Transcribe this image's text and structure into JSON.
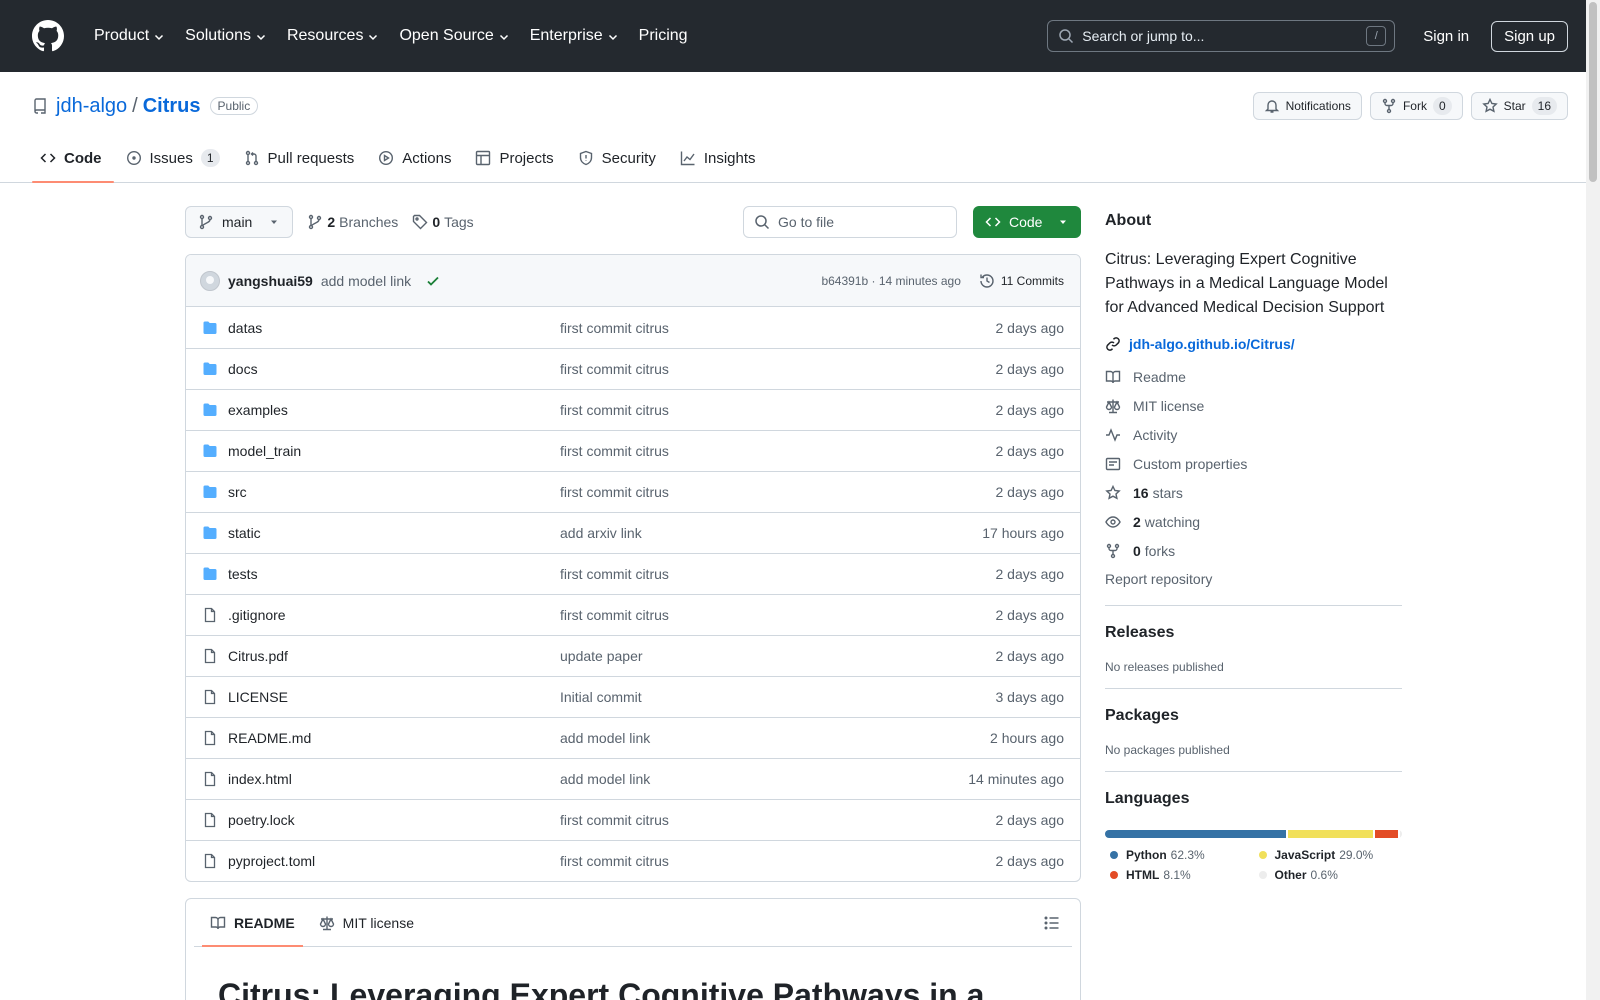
{
  "header": {
    "nav": [
      "Product",
      "Solutions",
      "Resources",
      "Open Source",
      "Enterprise",
      "Pricing"
    ],
    "search_placeholder": "Search or jump to...",
    "slash_key": "/",
    "signin": "Sign in",
    "signup": "Sign up"
  },
  "repo": {
    "owner": "jdh-algo",
    "separator": "/",
    "name": "Citrus",
    "visibility": "Public",
    "notifications_label": "Notifications",
    "fork_label": "Fork",
    "fork_count": "0",
    "star_label": "Star",
    "star_count": "16"
  },
  "tabs": {
    "code": "Code",
    "issues": "Issues",
    "issues_count": "1",
    "pulls": "Pull requests",
    "actions": "Actions",
    "projects": "Projects",
    "security": "Security",
    "insights": "Insights"
  },
  "toolbar": {
    "branch": "main",
    "branches_count": "2",
    "branches_label": "Branches",
    "tags_count": "0",
    "tags_label": "Tags",
    "goto_placeholder": "Go to file",
    "code_button": "Code"
  },
  "commit": {
    "author": "yangshuai59",
    "message": "add model link",
    "meta": "b64391b · 14 minutes ago",
    "commits_label": "11 Commits"
  },
  "files": [
    {
      "type": "folder",
      "name": "datas",
      "commit": "first commit citrus",
      "time": "2 days ago"
    },
    {
      "type": "folder",
      "name": "docs",
      "commit": "first commit citrus",
      "time": "2 days ago"
    },
    {
      "type": "folder",
      "name": "examples",
      "commit": "first commit citrus",
      "time": "2 days ago"
    },
    {
      "type": "folder",
      "name": "model_train",
      "commit": "first commit citrus",
      "time": "2 days ago"
    },
    {
      "type": "folder",
      "name": "src",
      "commit": "first commit citrus",
      "time": "2 days ago"
    },
    {
      "type": "folder",
      "name": "static",
      "commit": "add arxiv link",
      "time": "17 hours ago"
    },
    {
      "type": "folder",
      "name": "tests",
      "commit": "first commit citrus",
      "time": "2 days ago"
    },
    {
      "type": "file",
      "name": ".gitignore",
      "commit": "first commit citrus",
      "time": "2 days ago"
    },
    {
      "type": "file",
      "name": "Citrus.pdf",
      "commit": "update paper",
      "time": "2 days ago"
    },
    {
      "type": "file",
      "name": "LICENSE",
      "commit": "Initial commit",
      "time": "3 days ago"
    },
    {
      "type": "file",
      "name": "README.md",
      "commit": "add model link",
      "time": "2 hours ago"
    },
    {
      "type": "file",
      "name": "index.html",
      "commit": "add model link",
      "time": "14 minutes ago"
    },
    {
      "type": "file",
      "name": "poetry.lock",
      "commit": "first commit citrus",
      "time": "2 days ago"
    },
    {
      "type": "file",
      "name": "pyproject.toml",
      "commit": "first commit citrus",
      "time": "2 days ago"
    }
  ],
  "readme": {
    "tab_readme": "README",
    "tab_license": "MIT license",
    "heading": "Citrus: Leveraging Expert Cognitive Pathways in a"
  },
  "about": {
    "title": "About",
    "description": "Citrus: Leveraging Expert Cognitive Pathways in a Medical Language Model for Advanced Medical Decision Support",
    "link": "jdh-algo.github.io/Citrus/",
    "readme": "Readme",
    "license": "MIT license",
    "activity": "Activity",
    "custom_properties": "Custom properties",
    "stars_count": "16",
    "stars_label": "stars",
    "watching_count": "2",
    "watching_label": "watching",
    "forks_count": "0",
    "forks_label": "forks",
    "report": "Report repository"
  },
  "releases": {
    "title": "Releases",
    "note": "No releases published"
  },
  "packages": {
    "title": "Packages",
    "note": "No packages published"
  },
  "languages": {
    "title": "Languages",
    "items": [
      {
        "name": "Python",
        "percent": "62.3%",
        "value": 62.3,
        "color": "#3572A5"
      },
      {
        "name": "JavaScript",
        "percent": "29.0%",
        "value": 29.0,
        "color": "#f1e05a"
      },
      {
        "name": "HTML",
        "percent": "8.1%",
        "value": 8.1,
        "color": "#e34c26"
      },
      {
        "name": "Other",
        "percent": "0.6%",
        "value": 0.6,
        "color": "#ededed"
      }
    ]
  }
}
